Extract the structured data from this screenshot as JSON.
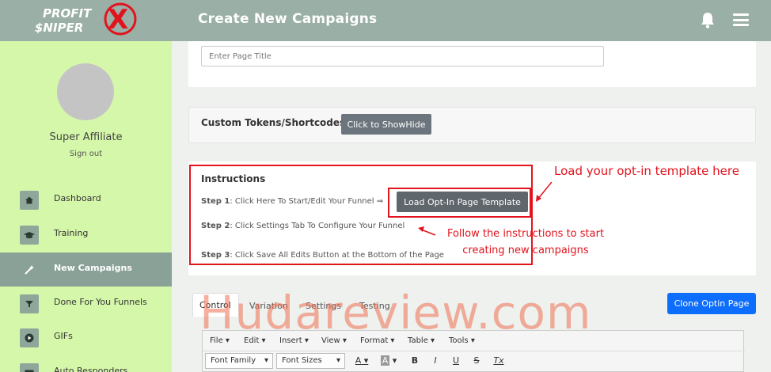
{
  "header": {
    "logo_line1": "PROFIT",
    "logo_line2": "$NIPER",
    "logo_mark": "X",
    "title": "Create New Campaigns",
    "bell_icon": "bell-icon",
    "menu_icon": "hamburger-icon",
    "bg_color": "#9aafa5"
  },
  "sidebar": {
    "username": "Super Affiliate",
    "signout": "Sign out",
    "bg_color": "#d5f7aa",
    "items": [
      {
        "label": "Dashboard",
        "icon": "home-icon"
      },
      {
        "label": "Training",
        "icon": "graduation-cap-icon"
      },
      {
        "label": "New Campaigns",
        "icon": "magic-wand-icon",
        "active": true
      },
      {
        "label": "Done For You Funnels",
        "icon": "filter-icon"
      },
      {
        "label": "GIFs",
        "icon": "play-circle-icon"
      },
      {
        "label": "Auto Responders",
        "icon": "envelope-icon"
      }
    ]
  },
  "page_title_input": {
    "placeholder": "Enter Page Title"
  },
  "tokens": {
    "title": "Custom Tokens/Shortcodes",
    "button": "Click to ShowHide"
  },
  "instructions": {
    "title": "Instructions",
    "step1_label": "Step 1",
    "step1_text": ": Click Here To Start/Edit Your Funnel ⇒",
    "load_button": "Load Opt-In Page Template",
    "step2_label": "Step 2",
    "step2_text": ": Click Settings Tab To Configure Your Funnel",
    "step3_label": "Step 3",
    "step3_text": ": Click Save All Edits Button at the Bottom of the Page"
  },
  "annotations": {
    "note1": "Load your opt-in template here",
    "note2_line1": "Follow the instructions to start",
    "note2_line2": "creating new campaigns",
    "color": "#e1141e"
  },
  "tabs": [
    "Control",
    "Variation",
    "Settings",
    "Testing"
  ],
  "clone_button": "Clone Optin Page",
  "editor": {
    "menus": [
      "File",
      "Edit",
      "Insert",
      "View",
      "Format",
      "Table",
      "Tools"
    ],
    "font_family": "Font Family",
    "font_sizes": "Font Sizes",
    "format_buttons": [
      "A",
      "A",
      "B",
      "I",
      "U",
      "S",
      "Tx"
    ]
  },
  "watermark": "Hudareview.com"
}
